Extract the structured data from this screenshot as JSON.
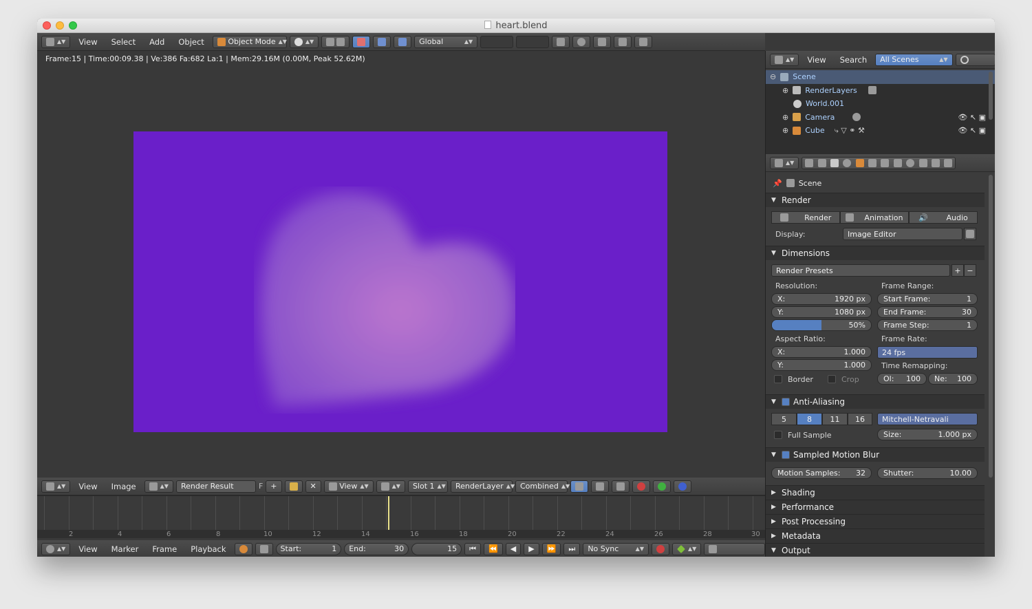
{
  "window": {
    "title": "heart.blend"
  },
  "view3d_header": {
    "menus": [
      "View",
      "Select",
      "Add",
      "Object"
    ],
    "mode": "Object Mode",
    "orientation": "Global"
  },
  "viewport": {
    "info": "Frame:15 | Time:00:09.38 | Ve:386 Fa:682 La:1 | Mem:29.16M (0.00M, Peak 52.62M)",
    "bg_color": "#6a1fc9",
    "heart_color": "#b873c8"
  },
  "image_header": {
    "menus": [
      "View",
      "Image"
    ],
    "image_name": "Render Result",
    "fake_user": "F",
    "view_label": "View",
    "slot": "Slot 1",
    "layer": "RenderLayer",
    "pass": "Combined"
  },
  "timeline": {
    "ticks": [
      "2",
      "4",
      "6",
      "8",
      "10",
      "12",
      "14",
      "16",
      "18",
      "20",
      "22",
      "24",
      "26",
      "28",
      "30"
    ],
    "current": 15
  },
  "timeline_header": {
    "menus": [
      "View",
      "Marker",
      "Frame",
      "Playback"
    ],
    "start_label": "Start:",
    "start_value": "1",
    "end_label": "End:",
    "end_value": "30",
    "current_frame": "15",
    "sync": "No Sync"
  },
  "outliner_header": {
    "menus": [
      "View",
      "Search"
    ],
    "filter": "All Scenes"
  },
  "outliner": {
    "items": [
      {
        "label": "Scene",
        "indent": 0
      },
      {
        "label": "RenderLayers",
        "indent": 1
      },
      {
        "label": "World.001",
        "indent": 1
      },
      {
        "label": "Camera",
        "indent": 1
      },
      {
        "label": "Cube",
        "indent": 1
      }
    ]
  },
  "properties": {
    "context": "Scene",
    "render": {
      "title": "Render",
      "render_btn": "Render",
      "animation_btn": "Animation",
      "audio_btn": "Audio",
      "display_label": "Display:",
      "display_value": "Image Editor"
    },
    "dimensions": {
      "title": "Dimensions",
      "presets": "Render Presets",
      "resolution_label": "Resolution:",
      "res_x_label": "X:",
      "res_x": "1920 px",
      "res_y_label": "Y:",
      "res_y": "1080 px",
      "res_pct": "50%",
      "res_pct_value": 0.5,
      "frame_range_label": "Frame Range:",
      "start_label": "Start Frame:",
      "start": "1",
      "end_label": "End Frame:",
      "end": "30",
      "step_label": "Frame Step:",
      "step": "1",
      "aspect_label": "Aspect Ratio:",
      "asp_x_label": "X:",
      "asp_x": "1.000",
      "asp_y_label": "Y:",
      "asp_y": "1.000",
      "frame_rate_label": "Frame Rate:",
      "frame_rate": "24 fps",
      "time_remap_label": "Time Remapping:",
      "old_label": "Ol:",
      "old": "100",
      "new_label": "Ne:",
      "new": "100",
      "border_label": "Border",
      "crop_label": "Crop"
    },
    "anti_aliasing": {
      "title": "Anti-Aliasing",
      "samples": [
        "5",
        "8",
        "11",
        "16"
      ],
      "filter": "Mitchell-Netravali",
      "full_sample_label": "Full Sample",
      "size_label": "Size:",
      "size": "1.000 px"
    },
    "motion_blur": {
      "title": "Sampled Motion Blur",
      "samples_label": "Motion Samples:",
      "samples": "32",
      "shutter_label": "Shutter:",
      "shutter": "10.00"
    },
    "collapsed": [
      "Shading",
      "Performance",
      "Post Processing",
      "Metadata"
    ],
    "output": "Output"
  }
}
